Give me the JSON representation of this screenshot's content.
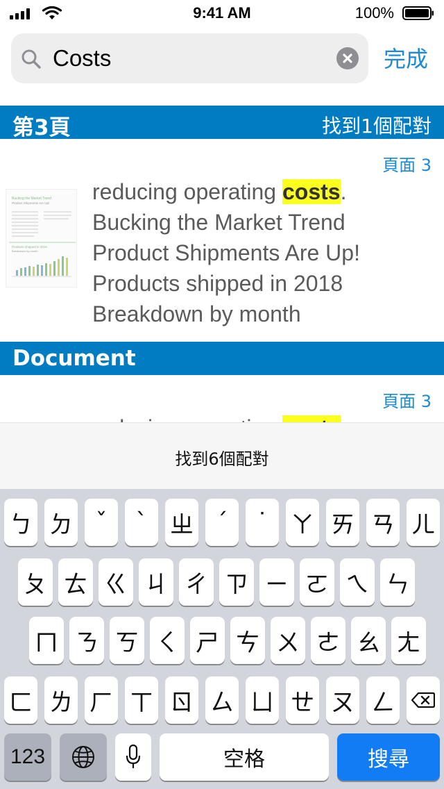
{
  "status_bar": {
    "time": "9:41 AM",
    "battery_percent": "100%",
    "battery_level": 1.0
  },
  "search": {
    "value": "Costs",
    "done_label": "完成"
  },
  "sections": [
    {
      "title": "第3頁",
      "count": "找到1個配對"
    },
    {
      "title": "Document"
    }
  ],
  "results": [
    {
      "page_label": "頁面 3",
      "text_before": "reducing operating ",
      "highlight": "costs",
      "text_after": ".",
      "lines": [
        "Bucking the Market Trend",
        "Product Shipments Are Up!",
        "Products shipped in 2018",
        "Breakdown by month"
      ],
      "thumbnail": {
        "title": "Bucking the Market Trend",
        "subtitle": "Product Shipments Are Up!",
        "chart_title": "Products shipped in 2018",
        "chart_subtitle": "Breakdown by month"
      }
    },
    {
      "page_label": "頁面 3",
      "text_before": "reducing operating ",
      "highlight": "costs"
    }
  ],
  "find_bar": {
    "text": "找到6個配對"
  },
  "keyboard": {
    "row1": [
      "ㄅ",
      "ㄉ",
      "ˇ",
      "ˋ",
      "ㄓ",
      "ˊ",
      "˙",
      "ㄚ",
      "ㄞ",
      "ㄢ",
      "ㄦ"
    ],
    "row2": [
      "ㄆ",
      "ㄊ",
      "ㄍ",
      "ㄐ",
      "ㄔ",
      "ㄗ",
      "ㄧ",
      "ㄛ",
      "ㄟ",
      "ㄣ"
    ],
    "row3": [
      "ㄇ",
      "ㄋ",
      "ㄎ",
      "ㄑ",
      "ㄕ",
      "ㄘ",
      "ㄨ",
      "ㄜ",
      "ㄠ",
      "ㄤ"
    ],
    "row4": [
      "ㄈ",
      "ㄌ",
      "ㄏ",
      "ㄒ",
      "ㄖ",
      "ㄙ",
      "ㄩ",
      "ㄝ",
      "ㄡ",
      "ㄥ"
    ],
    "numbers_label": "123",
    "space_label": "空格",
    "search_label": "搜尋",
    "icons": {
      "globe": "globe-icon",
      "mic": "microphone-icon",
      "delete": "backspace-icon"
    }
  },
  "colors": {
    "header": "#007cc2",
    "accent": "#1a8ad9",
    "highlight": "#fbff1d",
    "search_key": "#127cf4"
  }
}
